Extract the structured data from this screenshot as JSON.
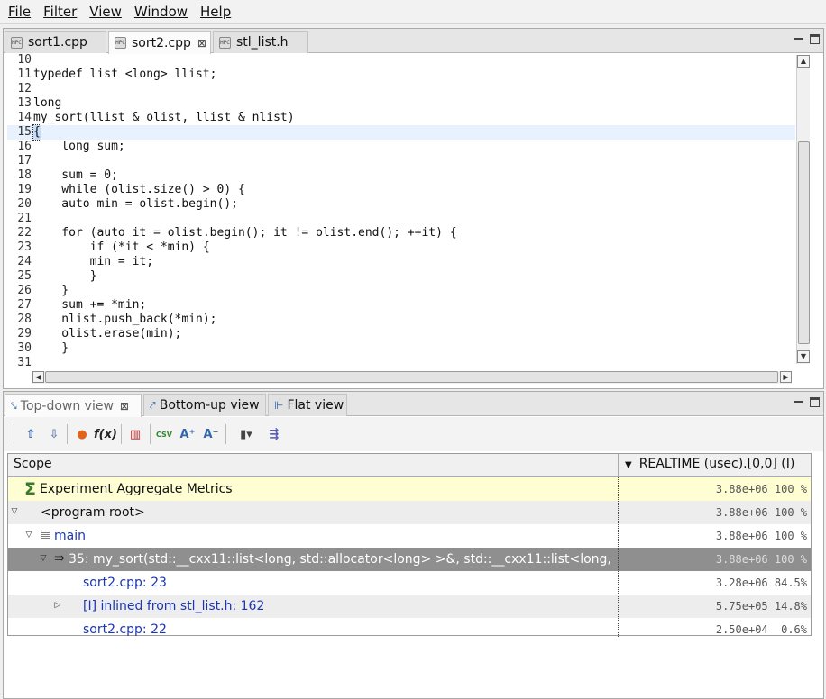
{
  "menu": [
    "File",
    "Filter",
    "View",
    "Window",
    "Help"
  ],
  "editor_tabs": [
    {
      "label": "sort1.cpp"
    },
    {
      "label": "sort2.cpp"
    },
    {
      "label": "stl_list.h"
    }
  ],
  "code_lines": [
    {
      "num": "10",
      "text": ""
    },
    {
      "num": "11",
      "text": "typedef list <long> llist;"
    },
    {
      "num": "12",
      "text": ""
    },
    {
      "num": "13",
      "text": "long"
    },
    {
      "num": "14",
      "text": "my_sort(llist & olist, llist & nlist)"
    },
    {
      "num": "15",
      "text": "{"
    },
    {
      "num": "16",
      "text": "    long sum;"
    },
    {
      "num": "17",
      "text": ""
    },
    {
      "num": "18",
      "text": "    sum = 0;"
    },
    {
      "num": "19",
      "text": "    while (olist.size() > 0) {"
    },
    {
      "num": "20",
      "text": "    auto min = olist.begin();"
    },
    {
      "num": "21",
      "text": ""
    },
    {
      "num": "22",
      "text": "    for (auto it = olist.begin(); it != olist.end(); ++it) {"
    },
    {
      "num": "23",
      "text": "        if (*it < *min) {"
    },
    {
      "num": "24",
      "text": "        min = it;"
    },
    {
      "num": "25",
      "text": "        }"
    },
    {
      "num": "26",
      "text": "    }"
    },
    {
      "num": "27",
      "text": "    sum += *min;"
    },
    {
      "num": "28",
      "text": "    nlist.push_back(*min);"
    },
    {
      "num": "29",
      "text": "    olist.erase(min);"
    },
    {
      "num": "30",
      "text": "    }"
    },
    {
      "num": "31",
      "text": ""
    }
  ],
  "view_tabs": [
    {
      "label": "Top-down view"
    },
    {
      "label": "Bottom-up view"
    },
    {
      "label": "Flat view"
    }
  ],
  "table": {
    "scope_header": "Scope",
    "metric_header": "REALTIME (usec).[0,0] (I)",
    "rows": [
      {
        "label": "Experiment Aggregate Metrics",
        "value": "3.88e+06 100 %"
      },
      {
        "label": "<program root>",
        "value": "3.88e+06 100 %"
      },
      {
        "label": "main",
        "value": "3.88e+06 100 %"
      },
      {
        "label": "35: my_sort(std::__cxx11::list<long, std::allocator<long> >&, std::__cxx11::list<long,",
        "value": "3.88e+06 100 %"
      },
      {
        "label": "sort2.cpp: 23",
        "value": "3.28e+06 84.5%"
      },
      {
        "label": "[I] inlined from stl_list.h: 162",
        "value": "5.75e+05 14.8%"
      },
      {
        "label": "sort2.cpp: 22",
        "value": "2.50e+04  0.6%"
      }
    ]
  }
}
